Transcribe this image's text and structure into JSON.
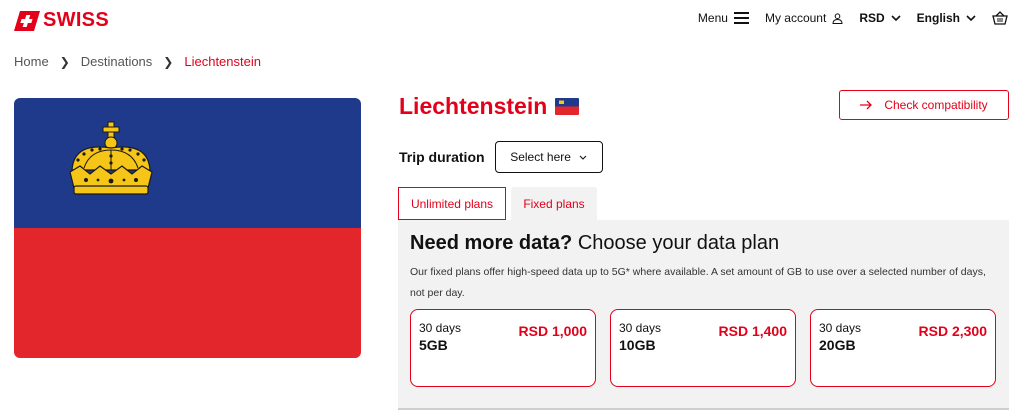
{
  "header": {
    "brand": "SWISS",
    "menu_label": "Menu",
    "account_label": "My account",
    "currency": "RSD",
    "language": "English"
  },
  "breadcrumb": [
    "Home",
    "Destinations",
    "Liechtenstein"
  ],
  "destination": {
    "title": "Liechtenstein",
    "check_button": "Check compatibility",
    "trip_label": "Trip duration",
    "trip_select_value": "Select here"
  },
  "tabs": [
    {
      "label": "Unlimited plans"
    },
    {
      "label": "Fixed plans"
    }
  ],
  "panel": {
    "heading_bold": "Need more data?",
    "heading_rest": " Choose your data plan",
    "description": "Our fixed plans offer high-speed data up to 5G* where available. A set amount of GB to use over a selected number of days, not per day.",
    "plans": [
      {
        "days": "30 days",
        "data": "5GB",
        "price": "RSD 1,000"
      },
      {
        "days": "30 days",
        "data": "10GB",
        "price": "RSD 1,400"
      },
      {
        "days": "30 days",
        "data": "20GB",
        "price": "RSD 2,300"
      }
    ]
  },
  "colors": {
    "brand_red": "#e2001a",
    "flag_blue": "#1f3a8a",
    "flag_red": "#e3262b",
    "crown_gold": "#f5c518"
  }
}
